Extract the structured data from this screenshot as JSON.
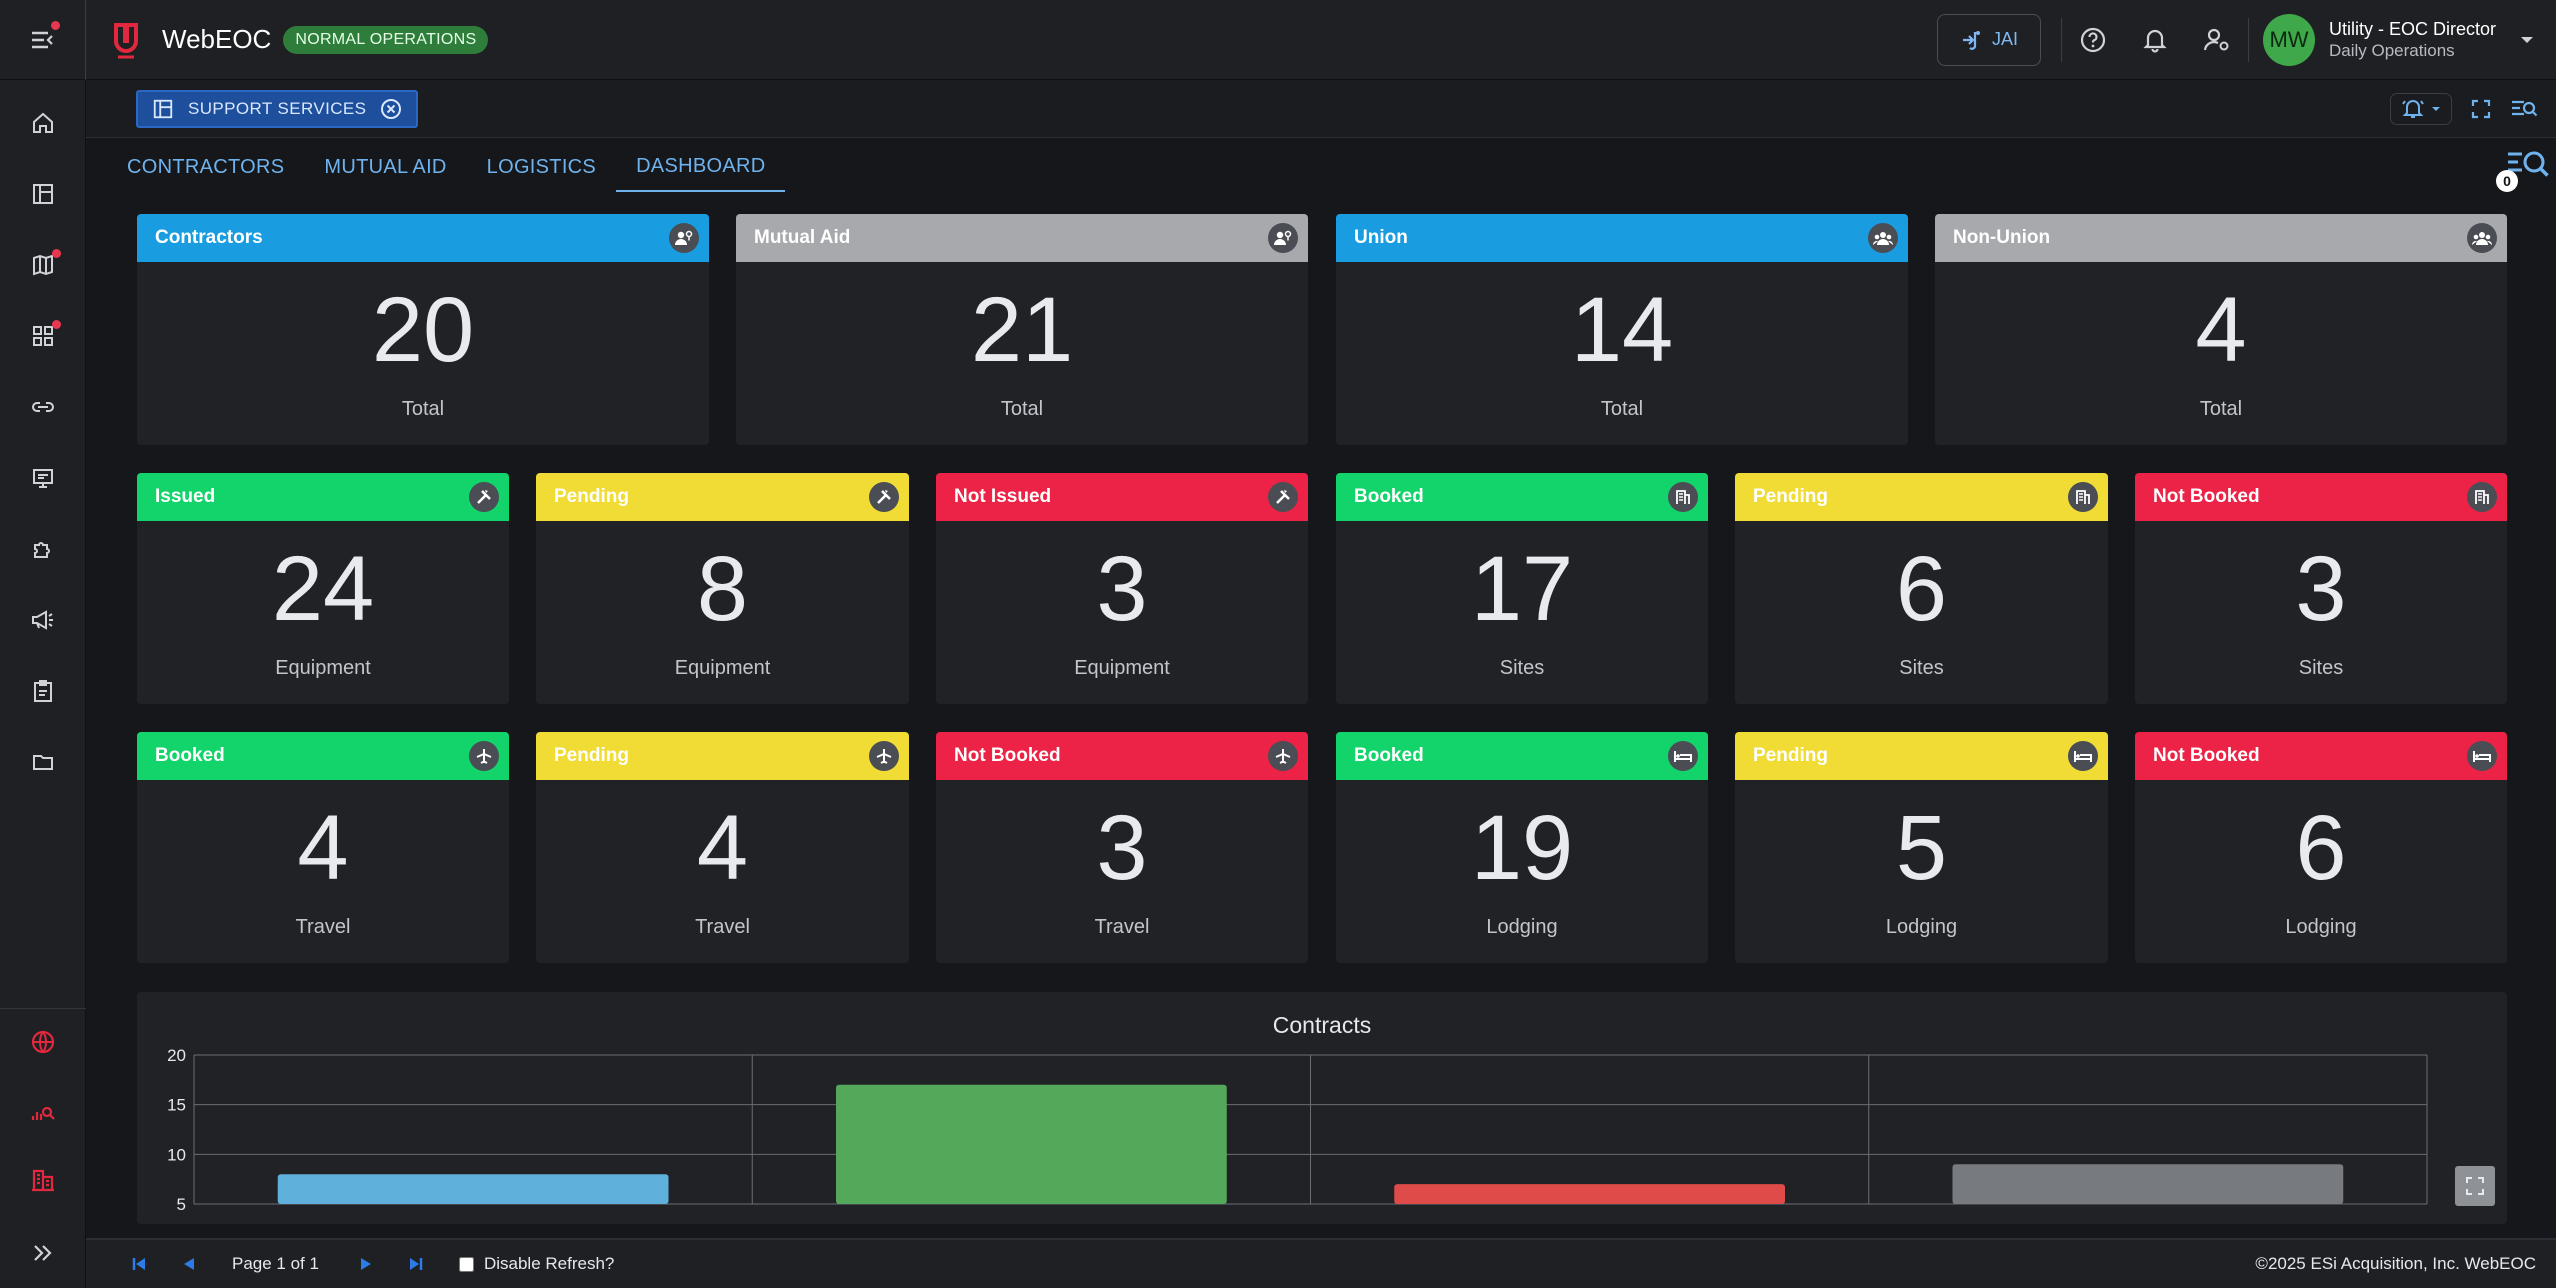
{
  "app": {
    "name": "WebEOC",
    "status": "NORMAL OPERATIONS"
  },
  "topbar": {
    "jai_label": "JAI",
    "user_initials": "MW",
    "user_name": "Utility - EOC Director",
    "user_org": "Daily Operations"
  },
  "sidebar": {
    "items": [
      "home-icon",
      "board-icon",
      "map-icon",
      "dashboard-icon",
      "link-icon",
      "display-icon",
      "plugin-icon",
      "megaphone-icon",
      "checklist-icon",
      "folder-icon"
    ],
    "bottom": [
      "globe-icon",
      "analytics-icon",
      "buildings-icon",
      "expand-icon"
    ]
  },
  "board_tab": {
    "label": "SUPPORT SERVICES"
  },
  "subnav": {
    "tabs": [
      "CONTRACTORS",
      "MUTUAL AID",
      "LOGISTICS",
      "DASHBOARD"
    ],
    "active": "DASHBOARD"
  },
  "filter_badge": "0",
  "cards": {
    "contractors": {
      "title": "Contractors",
      "value": "20",
      "sub": "Total",
      "icon": "person-badge-icon"
    },
    "mutual_aid": {
      "title": "Mutual Aid",
      "value": "21",
      "sub": "Total",
      "icon": "person-badge-icon"
    },
    "union": {
      "title": "Union",
      "value": "14",
      "sub": "Total",
      "icon": "group-icon"
    },
    "non_union": {
      "title": "Non-Union",
      "value": "4",
      "sub": "Total",
      "icon": "group-icon"
    },
    "equip_issued": {
      "title": "Issued",
      "value": "24",
      "sub": "Equipment",
      "icon": "tools-icon"
    },
    "equip_pending": {
      "title": "Pending",
      "value": "8",
      "sub": "Equipment",
      "icon": "tools-icon"
    },
    "equip_not_issued": {
      "title": "Not Issued",
      "value": "3",
      "sub": "Equipment",
      "icon": "tools-icon"
    },
    "sites_booked": {
      "title": "Booked",
      "value": "17",
      "sub": "Sites",
      "icon": "building-icon"
    },
    "sites_pending": {
      "title": "Pending",
      "value": "6",
      "sub": "Sites",
      "icon": "building-icon"
    },
    "sites_not_booked": {
      "title": "Not Booked",
      "value": "3",
      "sub": "Sites",
      "icon": "building-icon"
    },
    "travel_booked": {
      "title": "Booked",
      "value": "4",
      "sub": "Travel",
      "icon": "airplane-icon"
    },
    "travel_pending": {
      "title": "Pending",
      "value": "4",
      "sub": "Travel",
      "icon": "airplane-icon"
    },
    "travel_not_booked": {
      "title": "Not Booked",
      "value": "3",
      "sub": "Travel",
      "icon": "airplane-icon"
    },
    "lodging_booked": {
      "title": "Booked",
      "value": "19",
      "sub": "Lodging",
      "icon": "bed-icon"
    },
    "lodging_pending": {
      "title": "Pending",
      "value": "5",
      "sub": "Lodging",
      "icon": "bed-icon"
    },
    "lodging_not_booked": {
      "title": "Not Booked",
      "value": "6",
      "sub": "Lodging",
      "icon": "bed-icon"
    }
  },
  "colors": {
    "blue": "#1a9de0",
    "gray": "#a7a9ad",
    "green": "#13d46a",
    "yellow": "#f0dc34",
    "red": "#ec2346"
  },
  "chart_data": {
    "type": "bar",
    "title": "Contracts",
    "categories": [
      "",
      "",
      "",
      ""
    ],
    "values": [
      8,
      17,
      7,
      9
    ],
    "bar_colors": [
      "#5fb0db",
      "#53a85a",
      "#de4b49",
      "#777a7f"
    ],
    "ylim": [
      5,
      20
    ],
    "yticks": [
      20,
      15,
      10,
      5
    ],
    "grid": true,
    "xlabel": "",
    "ylabel": ""
  },
  "footer": {
    "page_info": "Page 1 of 1",
    "disable_refresh_label": "Disable Refresh?",
    "copyright": "©2025 ESi Acquisition, Inc. WebEOC"
  }
}
